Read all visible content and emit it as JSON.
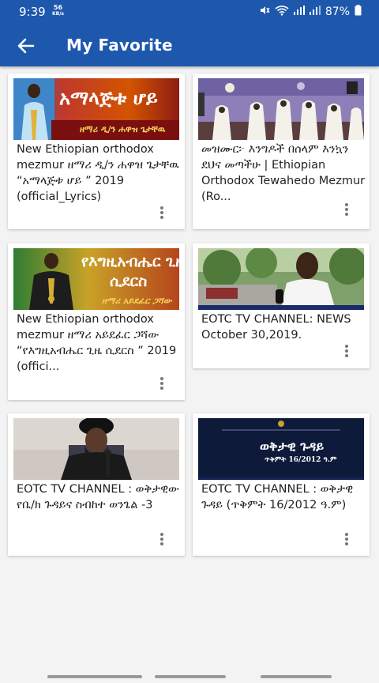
{
  "status": {
    "time": "9:39",
    "speed_value": "56",
    "speed_unit": "KB/s",
    "battery": "87%"
  },
  "appbar": {
    "title": "My Favorite"
  },
  "videos": [
    {
      "title": "New Ethiopian orthodox mezmur ዘማሪ ዲ/ን ሐዋዝ ጌታቸዉ “አማላጅቱ ሆይ ” 2019  (official_Lyrics)",
      "thumb_title": "አማላጅቱ ሆይ",
      "thumb_subtitle": "ዘማሪ ዲ/ን ሐዋዝ ጌታቸዉ"
    },
    {
      "title": "መዝሙር፦ እንግዶች በሰላም እንኳን ደህና መጣችሁ | Ethiopian Orthodox Tewahedo Mezmur (Ro..."
    },
    {
      "title": "New Ethiopian orthodox mezmur ዘማሪ አይደፈር ጋሻው “የእግዚአብሔር ጊዜ ሲደርስ ” 2019  (offici...",
      "thumb_title_1": "የእግዚአብሔር ጊዜ",
      "thumb_title_2": "ሲደርስ",
      "thumb_subtitle": "ዘማሪ አይደፈር ጋሻው"
    },
    {
      "title": "EOTC TV CHANNEL: NEWS October 30,2019."
    },
    {
      "title": "EOTC TV CHANNEL : ወቅታዊው የቤ/ክ ጉዳይና ስብከተ ወንጌል -3"
    },
    {
      "title": "EOTC TV CHANNEL : ወቅታዊ ጉዳይ (ጥቅምት 16/2012 ዓ.ም)",
      "thumb_title": "ወቅታዊ ጉዳይ",
      "thumb_subtitle": "ጥቅምት 16/2012 ዓ.ም"
    }
  ],
  "colors": {
    "primary": "#1e58ad",
    "background": "#f3f3f3",
    "card": "#ffffff",
    "text": "#222222",
    "menu_icon": "#777777"
  },
  "icons": [
    "back-arrow-icon",
    "mute-icon",
    "wifi-icon",
    "signal-icon",
    "battery-icon",
    "more-vert-icon"
  ]
}
